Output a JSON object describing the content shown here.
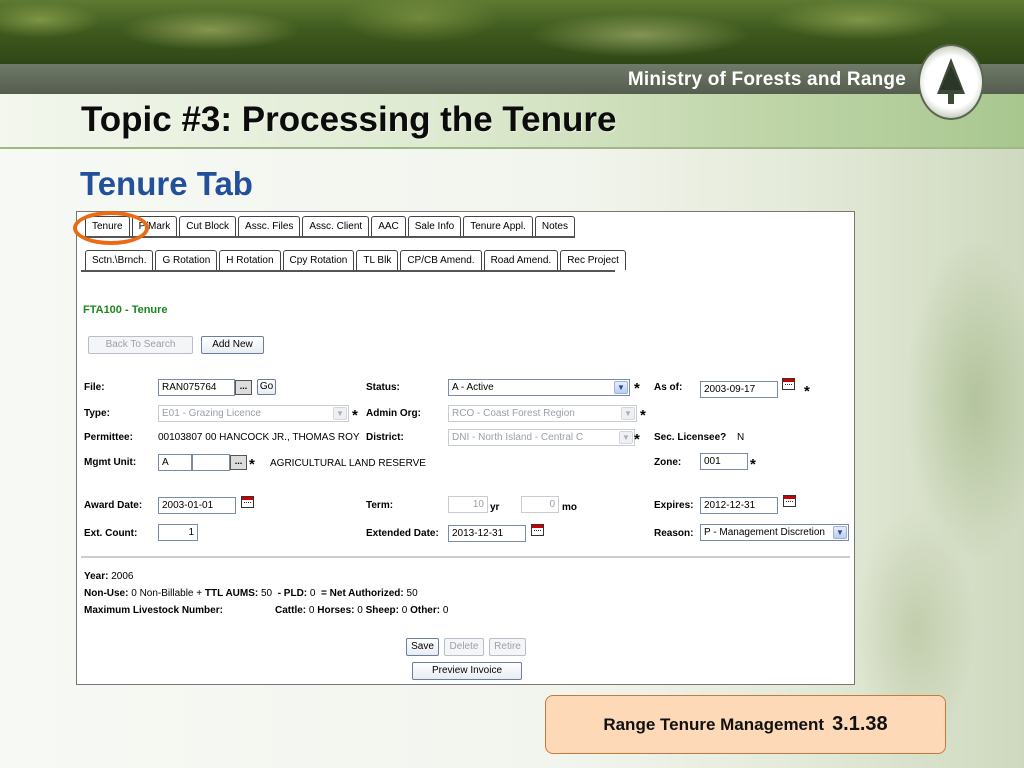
{
  "banner": {
    "ministry": "Ministry of Forests and Range"
  },
  "slide": {
    "title": "Topic #3: Processing the Tenure",
    "subtitle": "Tenure Tab"
  },
  "tabs_row1": [
    "Tenure",
    "P/Mark",
    "Cut Block",
    "Assc. Files",
    "Assc. Client",
    "AAC",
    "Sale Info",
    "Tenure Appl.",
    "Notes"
  ],
  "tabs_row2": [
    "Sctn.\\Brnch.",
    "G Rotation",
    "H Rotation",
    "Cpy Rotation",
    "TL Blk",
    "CP/CB Amend.",
    "Road Amend.",
    "Rec Project"
  ],
  "form": {
    "heading": "FTA100 - Tenure",
    "back_button": "Back To Search",
    "add_button": "Add New",
    "file_label": "File:",
    "file_value": "RAN075764",
    "file_lookup": "...",
    "go_button": "Go",
    "status_label": "Status:",
    "status_value": "A - Active",
    "asof_label": "As of:",
    "asof_value": "2003-09-17",
    "type_label": "Type:",
    "type_value": "E01 - Grazing Licence",
    "admin_label": "Admin Org:",
    "admin_value": "RCO - Coast Forest Region",
    "permittee_label": "Permittee:",
    "permittee_value": "00103807 00 HANCOCK JR., THOMAS ROY",
    "district_label": "District:",
    "district_value": "DNI - North Island - Central C",
    "licensee_label": "Sec. Licensee?",
    "licensee_value": "N",
    "mgmt_label": "Mgmt Unit:",
    "mgmt_value": "A",
    "mgmt_lookup": "...",
    "mgmt_desc": "AGRICULTURAL LAND RESERVE",
    "zone_label": "Zone:",
    "zone_value": "001",
    "award_label": "Award Date:",
    "award_value": "2003-01-01",
    "term_label": "Term:",
    "term_years": "10",
    "term_yr_unit": "yr",
    "term_months": "0",
    "term_mo_unit": "mo",
    "expires_label": "Expires:",
    "expires_value": "2012-12-31",
    "extcount_label": "Ext. Count:",
    "extcount_value": "1",
    "extended_label": "Extended Date:",
    "extended_value": "2013-12-31",
    "reason_label": "Reason:",
    "reason_value": "P - Management Discretion",
    "star": "*"
  },
  "summary": {
    "year_label": "Year:",
    "year_value": "2006",
    "nonuse_label": "Non-Use:",
    "nonuse_value": "0 Non-Billable +",
    "ttl_label": "TTL AUMS:",
    "ttl_value": "50",
    "pld_label": "- PLD:",
    "pld_value": "0",
    "net_label": "= Net Authorized:",
    "net_value": "50",
    "max_label": "Maximum Livestock Number:",
    "cattle_label": "Cattle:",
    "cattle_value": "0",
    "horses_label": "Horses:",
    "horses_value": "0",
    "sheep_label": "Sheep:",
    "sheep_value": "0",
    "other_label": "Other:",
    "other_value": "0"
  },
  "actions": {
    "save": "Save",
    "delete": "Delete",
    "retire": "Retire",
    "preview": "Preview Invoice"
  },
  "footer": {
    "name": "Range Tenure Management",
    "number": "3.1.38"
  },
  "colors": {
    "highlight_circle": "#ea6b15",
    "subtitle": "#22509a",
    "heading_green": "#19871c",
    "footer_bg": "#fdd9b8"
  }
}
